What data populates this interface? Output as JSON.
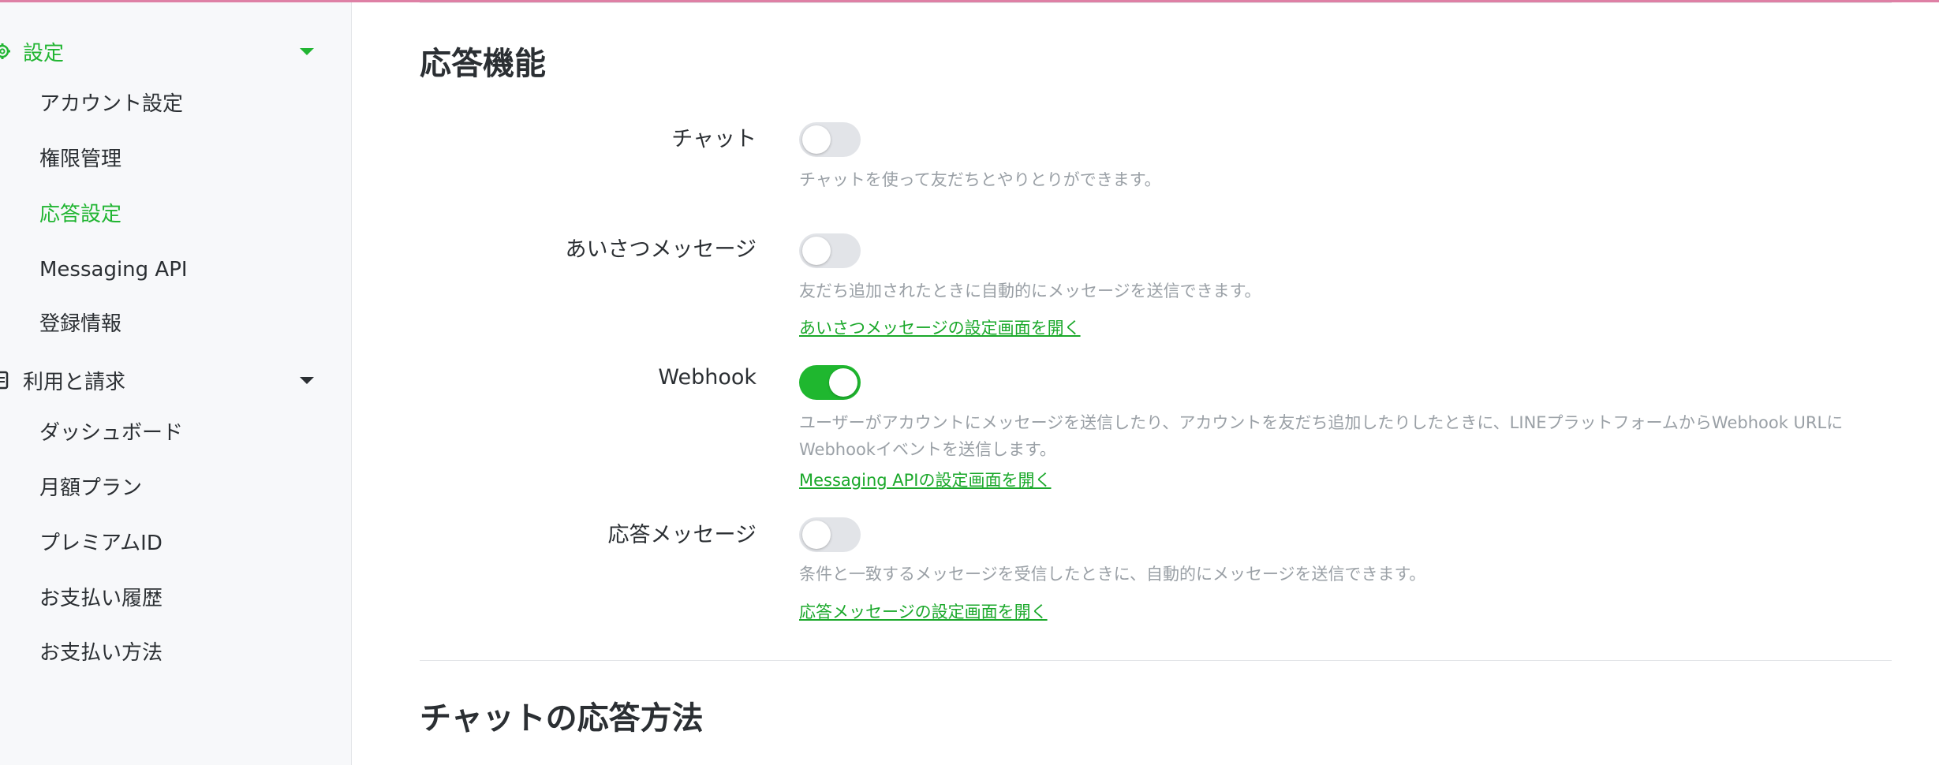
{
  "sidebar": {
    "groups": [
      {
        "label": "設定",
        "icon": "gear-icon",
        "items": [
          "アカウント設定",
          "権限管理",
          "応答設定",
          "Messaging API",
          "登録情報"
        ]
      },
      {
        "label": "利用と請求",
        "icon": "receipt-icon",
        "items": [
          "ダッシュボード",
          "月額プラン",
          "プレミアムID",
          "お支払い履歴",
          "お支払い方法"
        ]
      }
    ],
    "active_item": "応答設定"
  },
  "main": {
    "section1_title": "応答機能",
    "rows": [
      {
        "label": "チャット",
        "toggle_on": false,
        "desc": "チャットを使って友だちとやりとりができます。",
        "link": ""
      },
      {
        "label": "あいさつメッセージ",
        "toggle_on": false,
        "desc": "友だち追加されたときに自動的にメッセージを送信できます。",
        "link": "あいさつメッセージの設定画面を開く"
      },
      {
        "label": "Webhook",
        "toggle_on": true,
        "desc": "ユーザーがアカウントにメッセージを送信したり、アカウントを友だち追加したりしたときに、LINEプラットフォームからWebhook URLにWebhookイベントを送信します。",
        "link": "Messaging APIの設定画面を開く"
      },
      {
        "label": "応答メッセージ",
        "toggle_on": false,
        "desc": "条件と一致するメッセージを受信したときに、自動的にメッセージを送信できます。",
        "link": "応答メッセージの設定画面を開く"
      }
    ],
    "section2_title": "チャットの応答方法"
  },
  "colors": {
    "accent": "#21b532",
    "toggle_on": "#1fb72f",
    "toggle_off": "#e2e4e8",
    "muted_text": "#9aa0a6",
    "sidebar_bg": "#f7f8fa"
  }
}
